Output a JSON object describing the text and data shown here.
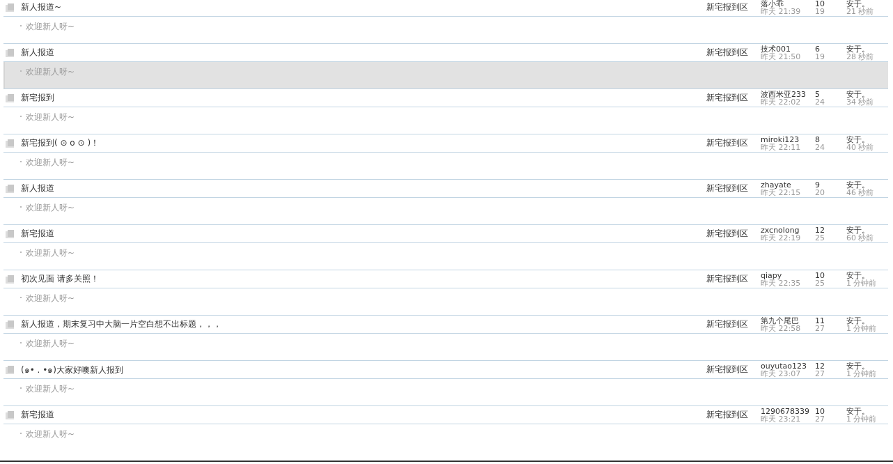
{
  "threads": [
    {
      "title": "新人报道~",
      "forum": "新宅报到区",
      "author": "落小乖",
      "posted": "昨天 21:39",
      "replies": "10",
      "views": "19",
      "last_poster": "安于。",
      "last_time": "21 秒前",
      "excerpt": "欢迎新人呀~",
      "highlighted": false
    },
    {
      "title": "新人报道",
      "forum": "新宅报到区",
      "author": "技术001",
      "posted": "昨天 21:50",
      "replies": "6",
      "views": "19",
      "last_poster": "安于。",
      "last_time": "28 秒前",
      "excerpt": "欢迎新人呀~",
      "highlighted": true
    },
    {
      "title": "新宅报到",
      "forum": "新宅报到区",
      "author": "波西米亚233",
      "posted": "昨天 22:02",
      "replies": "5",
      "views": "24",
      "last_poster": "安于。",
      "last_time": "34 秒前",
      "excerpt": "欢迎新人呀~",
      "highlighted": false
    },
    {
      "title": "新宅报到( ⊙ o ⊙ )！",
      "forum": "新宅报到区",
      "author": "miroki123",
      "posted": "昨天 22:11",
      "replies": "8",
      "views": "24",
      "last_poster": "安于。",
      "last_time": "40 秒前",
      "excerpt": "欢迎新人呀~",
      "highlighted": false
    },
    {
      "title": "新人报道",
      "forum": "新宅报到区",
      "author": "zhayate",
      "posted": "昨天 22:15",
      "replies": "9",
      "views": "20",
      "last_poster": "安于。",
      "last_time": "46 秒前",
      "excerpt": "欢迎新人呀~",
      "highlighted": false
    },
    {
      "title": "新宅报道",
      "forum": "新宅报到区",
      "author": "zxcnolong",
      "posted": "昨天 22:19",
      "replies": "12",
      "views": "25",
      "last_poster": "安于。",
      "last_time": "60 秒前",
      "excerpt": "欢迎新人呀~",
      "highlighted": false
    },
    {
      "title": "初次见面 请多关照！",
      "forum": "新宅报到区",
      "author": "qiapy",
      "posted": "昨天 22:35",
      "replies": "10",
      "views": "25",
      "last_poster": "安于。",
      "last_time": "1 分钟前",
      "excerpt": "欢迎新人呀~",
      "highlighted": false
    },
    {
      "title": "新人报道，期末复习中大脑一片空白想不出标题，，，",
      "forum": "新宅报到区",
      "author": "第九个尾巴",
      "posted": "昨天 22:58",
      "replies": "11",
      "views": "27",
      "last_poster": "安于。",
      "last_time": "1 分钟前",
      "excerpt": "欢迎新人呀~",
      "highlighted": false
    },
    {
      "title": "(๑• . •๑)大家好噢新人报到",
      "forum": "新宅报到区",
      "author": "ouyutao123",
      "posted": "昨天 23:07",
      "replies": "12",
      "views": "27",
      "last_poster": "安于。",
      "last_time": "1 分钟前",
      "excerpt": "欢迎新人呀~",
      "highlighted": false
    },
    {
      "title": "新宅报道",
      "forum": "新宅报到区",
      "author": "1290678339",
      "posted": "昨天 23:21",
      "replies": "10",
      "views": "27",
      "last_poster": "安于。",
      "last_time": "1 分钟前",
      "excerpt": "欢迎新人呀~",
      "highlighted": false
    }
  ]
}
